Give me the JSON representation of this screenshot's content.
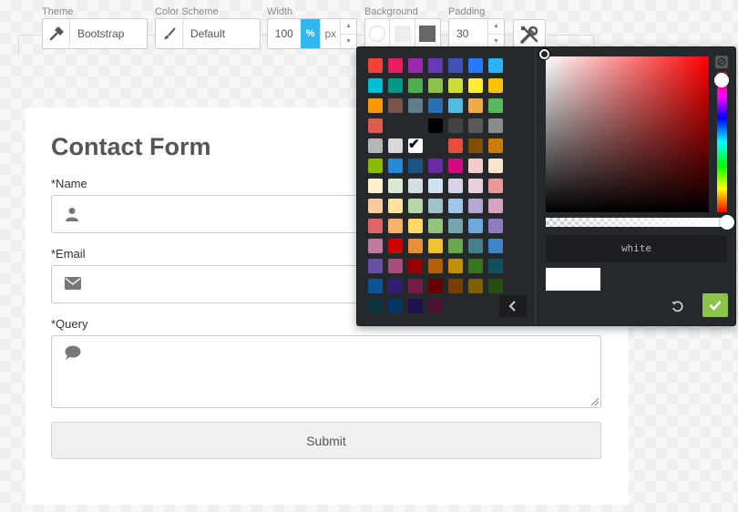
{
  "toolbar": {
    "theme": {
      "label": "Theme",
      "value": "Bootstrap",
      "icon": "hammer-icon"
    },
    "color_scheme": {
      "label": "Color Scheme",
      "value": "Default",
      "icon": "brush-icon"
    },
    "width": {
      "label": "Width",
      "value": "100",
      "unit_percent": "%",
      "unit_px": "px"
    },
    "background": {
      "label": "Background",
      "swatches": [
        "#ffffff",
        "#eeeeee",
        "#666666"
      ]
    },
    "padding": {
      "label": "Padding",
      "value": "30"
    },
    "tools_icon": "tools-icon"
  },
  "form": {
    "title": "Contact Form",
    "fields": [
      {
        "label": "*Name",
        "icon": "user-icon"
      },
      {
        "label": "*Email",
        "icon": "envelope-icon"
      },
      {
        "label": "*Query",
        "icon": "comment-icon"
      }
    ],
    "submit_label": "Submit"
  },
  "color_picker": {
    "palette": [
      [
        "#f44336",
        "#e91e63",
        "#9c27b0",
        "#673ab7",
        "#3f51b5",
        "#2979ff",
        "#29b6f6",
        "#00bcd4"
      ],
      [
        "#009688",
        "#4caf50",
        "#8bc34a",
        "#cddc39",
        "#ffeb3b",
        "#ffc107",
        "#ff9800",
        "#795548"
      ],
      [
        "#607d8b",
        "#2d6fb4",
        "#50bde0",
        "#f0a94b",
        "#58b85e",
        "#e05b4f"
      ],
      [
        "#000000",
        "#434343",
        "#595959",
        "#8b8b8b",
        "#b7b7b7",
        "#d9d9d9",
        "#ffffff"
      ],
      [
        "#e74c3c",
        "#7f4f0c",
        "#cd7d0b",
        "#8ab906",
        "#2589d6",
        "#1c5486",
        "#6b2aa3",
        "#d10c80"
      ],
      [
        "#f4cccc",
        "#fce5cd",
        "#fff2cc",
        "#d9ead3",
        "#d0e0e3",
        "#cfe2f3",
        "#d9d2e9",
        "#ead1dc"
      ],
      [
        "#ea9999",
        "#f9cb9c",
        "#ffe599",
        "#b6d7a8",
        "#a2c4c9",
        "#9fc5e8",
        "#b4a7d6",
        "#d5a6bd"
      ],
      [
        "#e06666",
        "#f6b26b",
        "#ffd966",
        "#93c47d",
        "#76a5af",
        "#6fa8dc",
        "#8e7cc3",
        "#c27ba0"
      ],
      [
        "#cc0000",
        "#e69138",
        "#f1c232",
        "#6aa84f",
        "#45818e",
        "#3d85c6",
        "#674ea7",
        "#a64d79"
      ],
      [
        "#990000",
        "#b45f06",
        "#bf9000",
        "#38761d",
        "#134f5c",
        "#0b5394",
        "#351c75",
        "#741b47"
      ],
      [
        "#660000",
        "#783f04",
        "#7f6000",
        "#274e13",
        "#0c343d",
        "#073763",
        "#20124d",
        "#4c1130"
      ]
    ],
    "selected_color": "#ffffff",
    "color_value": "white",
    "hue_color": "#ff0000",
    "preview_color": "#ffffff",
    "ok_color": "#8cc34a"
  }
}
